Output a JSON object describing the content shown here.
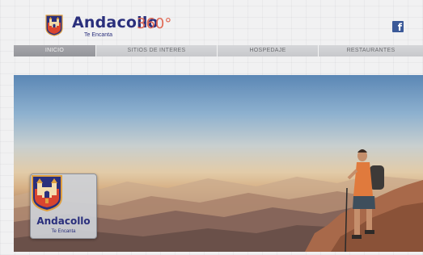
{
  "header": {
    "brand_name": "Andacollo",
    "brand_360": "360°",
    "tagline": "Te Encanta",
    "facebook_glyph": "f",
    "emblem_icon": "andacollo-shield-icon",
    "social_icon": "facebook-icon"
  },
  "nav": {
    "items": [
      {
        "label": "INICIO",
        "active": true
      },
      {
        "label": "SITIOS DE INTERES",
        "active": false
      },
      {
        "label": "HOSPEDAJE",
        "active": false
      },
      {
        "label": "RESTAURANTES",
        "active": false
      }
    ]
  },
  "hero": {
    "badge_name": "Andacollo",
    "badge_tagline": "Te Encanta"
  },
  "colors": {
    "brand_blue": "#2a2f7c",
    "brand_accent": "#e06a55",
    "nav_active": "#9d9ea3",
    "facebook_blue": "#3b5998"
  }
}
